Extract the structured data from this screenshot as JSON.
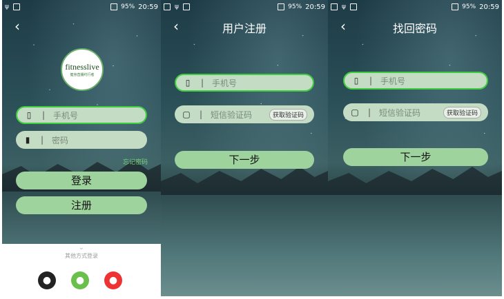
{
  "status": {
    "battery": "95%",
    "time": "20:59"
  },
  "login": {
    "logo_main": "fitnesslive",
    "logo_sub": "健身直播约行者",
    "phone_placeholder": "手机号",
    "password_placeholder": "密码",
    "forgot_label": "忘记密码",
    "login_label": "登录",
    "register_label": "注册",
    "other_login_label": "其他方式登录"
  },
  "register": {
    "title": "用户注册",
    "phone_placeholder": "手机号",
    "sms_placeholder": "短信验证码",
    "get_code_label": "获取验证码",
    "next_label": "下一步"
  },
  "recover": {
    "title": "找回密码",
    "phone_placeholder": "手机号",
    "sms_placeholder": "短信验证码",
    "get_code_label": "获取验证码",
    "next_label": "下一步"
  },
  "icons": [
    "back-icon",
    "phone-icon",
    "lock-icon",
    "sms-icon",
    "qq-icon",
    "wechat-icon",
    "weibo-icon"
  ]
}
